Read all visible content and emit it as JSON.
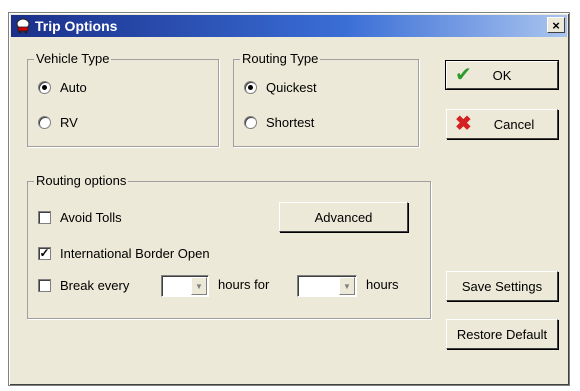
{
  "window": {
    "title": "Trip Options",
    "close_label": "×"
  },
  "vehicle_type": {
    "legend": "Vehicle Type",
    "options": [
      {
        "label": "Auto",
        "selected": true
      },
      {
        "label": "RV",
        "selected": false
      }
    ]
  },
  "routing_type": {
    "legend": "Routing Type",
    "options": [
      {
        "label": "Quickest",
        "selected": true
      },
      {
        "label": "Shortest",
        "selected": false
      }
    ]
  },
  "routing_options": {
    "legend": "Routing options",
    "avoid_tolls": {
      "label": "Avoid Tolls",
      "checked": false
    },
    "border_open": {
      "label": "International Border Open",
      "checked": true
    },
    "break_every": {
      "label": "Break every",
      "checked": false,
      "value": ""
    },
    "hours_for_label": "hours for",
    "hours_for_value": "",
    "hours_label": "hours",
    "advanced_button": "Advanced"
  },
  "buttons": {
    "ok": "OK",
    "cancel": "Cancel",
    "save_settings": "Save Settings",
    "restore_default": "Restore Default"
  },
  "icons": {
    "ok": "green-checkmark-icon",
    "cancel": "red-x-icon",
    "app": "car-icon"
  },
  "colors": {
    "title_bar_start": "#1a2f8a",
    "title_bar_end": "#a9c4ef",
    "dialog_bg": "#ece9d8",
    "ok_check": "#2e9a2e",
    "cancel_x": "#d42020"
  }
}
